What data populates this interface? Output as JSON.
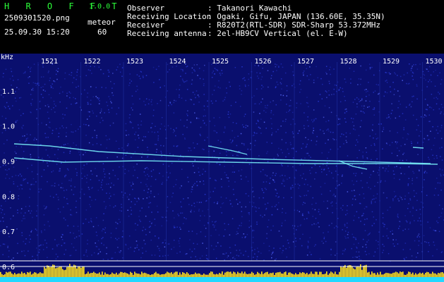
{
  "header": {
    "app_title": "H R O F F T",
    "version": "1.0.0",
    "filename": "2509301520.png",
    "mode": "meteor",
    "datetime": "25.09.30 15:20",
    "count": "60",
    "info_labels": [
      "Observer",
      "Receiving Location",
      "Receiver",
      "Receiving antenna"
    ],
    "info_values": [
      ": Takanori Kawachi",
      ": Ogaki, Gifu, JAPAN (136.60E, 35.35N)",
      ": R820T2(RTL-SDR) SDR-Sharp 53.372MHz",
      ": 2el-HB9CV Vertical (el. E-W)"
    ]
  },
  "spectrogram": {
    "y_axis_unit": "kHz",
    "y_ticks": [
      "1.1",
      "1.0",
      "0.9",
      "0.8",
      "0.7",
      "0.6"
    ],
    "y_range": [
      0.6,
      1.15
    ],
    "x_ticks": [
      "1521",
      "1522",
      "1523",
      "1524",
      "1525",
      "1526",
      "1527",
      "1528",
      "1529",
      "1530"
    ],
    "colors": {
      "background": "#0a0f6e",
      "noise": "#2a3bd8",
      "signal": "#7cf8ff",
      "baseline": "#ffffff",
      "level_bar": "#ffe21f",
      "level_base": "#22d8ff"
    }
  }
}
